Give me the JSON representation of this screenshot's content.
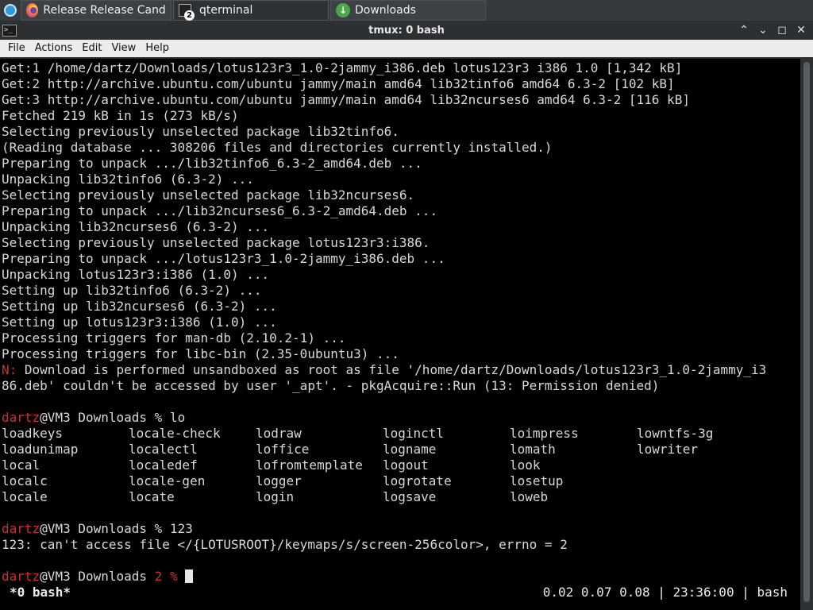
{
  "taskbar": {
    "tasks": [
      {
        "label": "Release Release Candid...",
        "icon": "firefox-icon"
      },
      {
        "label": "qterminal",
        "icon": "terminal-icon",
        "badge": "2"
      },
      {
        "label": "Downloads",
        "icon": "download-icon"
      }
    ]
  },
  "window": {
    "title": "tmux: 0 bash",
    "icon_text": ">_",
    "buttons": {
      "min": "⌃",
      "max": "⌄",
      "restore": "◻",
      "close": "✕"
    }
  },
  "menubar": {
    "items": [
      "File",
      "Actions",
      "Edit",
      "View",
      "Help"
    ]
  },
  "terminal": {
    "lines": [
      "Get:1 /home/dartz/Downloads/lotus123r3_1.0-2jammy_i386.deb lotus123r3 i386 1.0 [1,342 kB]",
      "Get:2 http://archive.ubuntu.com/ubuntu jammy/main amd64 lib32tinfo6 amd64 6.3-2 [102 kB]",
      "Get:3 http://archive.ubuntu.com/ubuntu jammy/main amd64 lib32ncurses6 amd64 6.3-2 [116 kB]",
      "Fetched 219 kB in 1s (273 kB/s)",
      "Selecting previously unselected package lib32tinfo6.",
      "(Reading database ... 308206 files and directories currently installed.)",
      "Preparing to unpack .../lib32tinfo6_6.3-2_amd64.deb ...",
      "Unpacking lib32tinfo6 (6.3-2) ...",
      "Selecting previously unselected package lib32ncurses6.",
      "Preparing to unpack .../lib32ncurses6_6.3-2_amd64.deb ...",
      "Unpacking lib32ncurses6 (6.3-2) ...",
      "Selecting previously unselected package lotus123r3:i386.",
      "Preparing to unpack .../lotus123r3_1.0-2jammy_i386.deb ...",
      "Unpacking lotus123r3:i386 (1.0) ...",
      "Setting up lib32tinfo6 (6.3-2) ...",
      "Setting up lib32ncurses6 (6.3-2) ...",
      "Setting up lotus123r3:i386 (1.0) ...",
      "Processing triggers for man-db (2.10.2-1) ...",
      "Processing triggers for libc-bin (2.35-0ubuntu3) ..."
    ],
    "notice_prefix": "N:",
    "notice_line1": " Download is performed unsandboxed as root as file '/home/dartz/Downloads/lotus123r3_1.0-2jammy_i3",
    "notice_line2": "86.deb' couldn't be accessed by user '_apt'. - pkgAcquire::Run (13: Permission denied)",
    "prompt_user": "dartz",
    "prompt_host_dir": "@VM3 Downloads",
    "cmd1": " % lo",
    "completions": [
      [
        "loadkeys",
        "locale-check",
        "lodraw",
        "loginctl",
        "loimpress",
        "lowntfs-3g"
      ],
      [
        "loadunimap",
        "localectl",
        "loffice",
        "logname",
        "lomath",
        "lowriter"
      ],
      [
        "local",
        "localedef",
        "lofromtemplate",
        "logout",
        "look",
        ""
      ],
      [
        "localc",
        "locale-gen",
        "logger",
        "logrotate",
        "losetup",
        ""
      ],
      [
        "locale",
        "locate",
        "login",
        "logsave",
        "loweb",
        ""
      ]
    ],
    "cmd2": " % 123",
    "error_line": "123: can't access file </{LOTUSROOT}/keymaps/s/screen-256color>, errno = 2",
    "exit_code": "2",
    "prompt_tail": " % "
  },
  "tmux_status": {
    "left": "*0 bash*",
    "right": "0.02 0.07 0.08 | 23:36:00 | bash"
  }
}
